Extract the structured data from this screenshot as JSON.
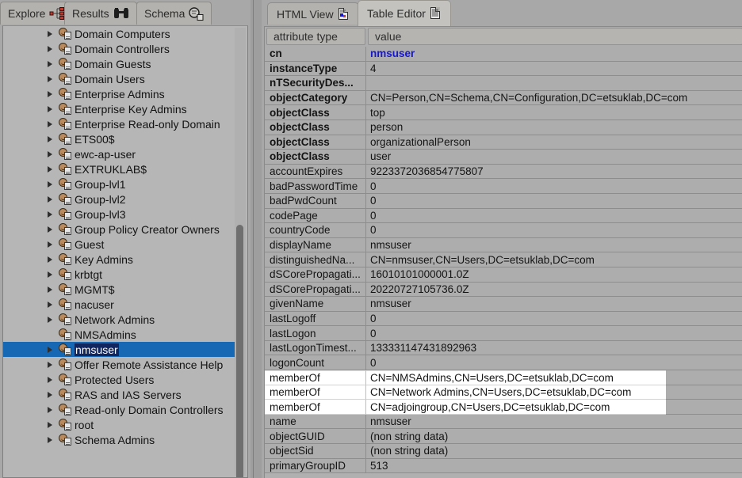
{
  "left_panel": {
    "tabs": [
      {
        "label": "Explore",
        "icon": "tree-explore-icon",
        "selected": false
      },
      {
        "label": "Results",
        "icon": "binoculars-icon",
        "selected": false
      },
      {
        "label": "Schema",
        "icon": "schema-magnifier-icon",
        "selected": false
      }
    ],
    "tree": {
      "selected_item": "nmsuser",
      "scroll_thumb_top_pct": 44,
      "scroll_thumb_height_pct": 58,
      "items": [
        {
          "label": "Domain Computers",
          "expandable": true,
          "selected": false
        },
        {
          "label": "Domain Controllers",
          "expandable": true,
          "selected": false
        },
        {
          "label": "Domain Guests",
          "expandable": true,
          "selected": false
        },
        {
          "label": "Domain Users",
          "expandable": true,
          "selected": false
        },
        {
          "label": "Enterprise Admins",
          "expandable": true,
          "selected": false
        },
        {
          "label": "Enterprise Key Admins",
          "expandable": true,
          "selected": false
        },
        {
          "label": "Enterprise Read-only Domain",
          "expandable": true,
          "selected": false
        },
        {
          "label": "ETS00$",
          "expandable": true,
          "selected": false
        },
        {
          "label": "ewc-ap-user",
          "expandable": true,
          "selected": false
        },
        {
          "label": "EXTRUKLAB$",
          "expandable": true,
          "selected": false
        },
        {
          "label": "Group-lvl1",
          "expandable": true,
          "selected": false
        },
        {
          "label": "Group-lvl2",
          "expandable": true,
          "selected": false
        },
        {
          "label": "Group-lvl3",
          "expandable": true,
          "selected": false
        },
        {
          "label": "Group Policy Creator Owners",
          "expandable": true,
          "selected": false
        },
        {
          "label": "Guest",
          "expandable": true,
          "selected": false
        },
        {
          "label": "Key Admins",
          "expandable": true,
          "selected": false
        },
        {
          "label": "krbtgt",
          "expandable": true,
          "selected": false
        },
        {
          "label": "MGMT$",
          "expandable": true,
          "selected": false
        },
        {
          "label": "nacuser",
          "expandable": true,
          "selected": false
        },
        {
          "label": "Network Admins",
          "expandable": true,
          "selected": false
        },
        {
          "label": "NMSAdmins",
          "expandable": false,
          "selected": false
        },
        {
          "label": "nmsuser",
          "expandable": true,
          "selected": true
        },
        {
          "label": "Offer Remote Assistance Help",
          "expandable": true,
          "selected": false
        },
        {
          "label": "Protected Users",
          "expandable": true,
          "selected": false
        },
        {
          "label": "RAS and IAS Servers",
          "expandable": true,
          "selected": false
        },
        {
          "label": "Read-only Domain Controllers",
          "expandable": true,
          "selected": false
        },
        {
          "label": "root",
          "expandable": true,
          "selected": false
        },
        {
          "label": "Schema Admins",
          "expandable": true,
          "selected": false
        }
      ]
    }
  },
  "right_panel": {
    "tabs": [
      {
        "label": "HTML View",
        "icon": "html-page-icon",
        "selected": false
      },
      {
        "label": "Table Editor",
        "icon": "table-page-icon",
        "selected": true
      }
    ],
    "table": {
      "columns": [
        "attribute type",
        "value"
      ],
      "rows": [
        {
          "attribute": "cn",
          "value": "nmsuser",
          "bold": true,
          "link": true,
          "highlight": false
        },
        {
          "attribute": "instanceType",
          "value": "4",
          "bold": true,
          "link": false,
          "highlight": false
        },
        {
          "attribute": "nTSecurityDes...",
          "value": "",
          "bold": true,
          "link": false,
          "highlight": false
        },
        {
          "attribute": "objectCategory",
          "value": "CN=Person,CN=Schema,CN=Configuration,DC=etsuklab,DC=com",
          "bold": true,
          "link": false,
          "highlight": false
        },
        {
          "attribute": "objectClass",
          "value": "top",
          "bold": true,
          "link": false,
          "highlight": false
        },
        {
          "attribute": "objectClass",
          "value": "person",
          "bold": true,
          "link": false,
          "highlight": false
        },
        {
          "attribute": "objectClass",
          "value": "organizationalPerson",
          "bold": true,
          "link": false,
          "highlight": false
        },
        {
          "attribute": "objectClass",
          "value": "user",
          "bold": true,
          "link": false,
          "highlight": false
        },
        {
          "attribute": "accountExpires",
          "value": "9223372036854775807",
          "bold": false,
          "link": false,
          "highlight": false
        },
        {
          "attribute": "badPasswordTime",
          "value": "0",
          "bold": false,
          "link": false,
          "highlight": false
        },
        {
          "attribute": "badPwdCount",
          "value": "0",
          "bold": false,
          "link": false,
          "highlight": false
        },
        {
          "attribute": "codePage",
          "value": "0",
          "bold": false,
          "link": false,
          "highlight": false
        },
        {
          "attribute": "countryCode",
          "value": "0",
          "bold": false,
          "link": false,
          "highlight": false
        },
        {
          "attribute": "displayName",
          "value": "nmsuser",
          "bold": false,
          "link": false,
          "highlight": false
        },
        {
          "attribute": "distinguishedNa...",
          "value": "CN=nmsuser,CN=Users,DC=etsuklab,DC=com",
          "bold": false,
          "link": false,
          "highlight": false
        },
        {
          "attribute": "dSCorePropagati...",
          "value": "16010101000001.0Z",
          "bold": false,
          "link": false,
          "highlight": false
        },
        {
          "attribute": "dSCorePropagati...",
          "value": "20220727105736.0Z",
          "bold": false,
          "link": false,
          "highlight": false
        },
        {
          "attribute": "givenName",
          "value": "nmsuser",
          "bold": false,
          "link": false,
          "highlight": false
        },
        {
          "attribute": "lastLogoff",
          "value": "0",
          "bold": false,
          "link": false,
          "highlight": false
        },
        {
          "attribute": "lastLogon",
          "value": "0",
          "bold": false,
          "link": false,
          "highlight": false
        },
        {
          "attribute": "lastLogonTimest...",
          "value": "133331147431892963",
          "bold": false,
          "link": false,
          "highlight": false
        },
        {
          "attribute": "logonCount",
          "value": "0",
          "bold": false,
          "link": false,
          "highlight": false
        },
        {
          "attribute": "memberOf",
          "value": "CN=NMSAdmins,CN=Users,DC=etsuklab,DC=com",
          "bold": false,
          "link": false,
          "highlight": true
        },
        {
          "attribute": "memberOf",
          "value": "CN=Network Admins,CN=Users,DC=etsuklab,DC=com",
          "bold": false,
          "link": false,
          "highlight": true
        },
        {
          "attribute": "memberOf",
          "value": "CN=adjoingroup,CN=Users,DC=etsuklab,DC=com",
          "bold": false,
          "link": false,
          "highlight": true
        },
        {
          "attribute": "name",
          "value": "nmsuser",
          "bold": false,
          "link": false,
          "highlight": false
        },
        {
          "attribute": "objectGUID",
          "value": "(non string data)",
          "bold": false,
          "link": false,
          "highlight": false
        },
        {
          "attribute": "objectSid",
          "value": "(non string data)",
          "bold": false,
          "link": false,
          "highlight": false
        },
        {
          "attribute": "primaryGroupID",
          "value": "513",
          "bold": false,
          "link": false,
          "highlight": false
        }
      ]
    }
  },
  "colors": {
    "selection_blue": "#1668b5",
    "selection_text_bg": "#11265e",
    "link_blue": "#1717cf",
    "panel_gray": "#adadad",
    "highlight_white": "#ffffff"
  }
}
